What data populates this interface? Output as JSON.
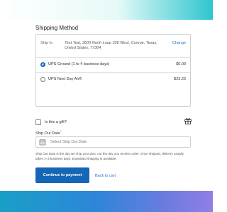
{
  "section_title": "Shipping Method",
  "ship_to": {
    "label": "Ship to",
    "address_line1": "Test Test, 3600 North Loop 336 West, Conroe, Texas,",
    "address_line2": "United States, 77304",
    "change_label": "Change"
  },
  "shipping_options": [
    {
      "label": "UPS Ground (1 to 4 business days)",
      "price": "$0.00",
      "selected": true
    },
    {
      "label": "UPS Next Day Air®",
      "price": "$23.23",
      "selected": false
    }
  ],
  "gift": {
    "label": "Is this a gift?",
    "checked": false,
    "icon": "gift-icon"
  },
  "ship_out_date": {
    "label": "Ship Out Date",
    "required_marker": "*",
    "placeholder": "Select Ship Out Date",
    "icon": "calendar-icon",
    "help_text": "Ship Out Date is the day we ship your pies, not the day you receive order. Once shipped, delivery usually takes 1–3 business days. Expedited shipping is available."
  },
  "actions": {
    "continue_label": "Continue to payment",
    "back_label": "Back to cart"
  },
  "colors": {
    "accent": "#1766b6",
    "link": "#1d6fc4",
    "header_gradient_end": "#2ec6cf",
    "footer_gradient_start": "#1a9fc7",
    "footer_gradient_end": "#8f7fe4"
  }
}
